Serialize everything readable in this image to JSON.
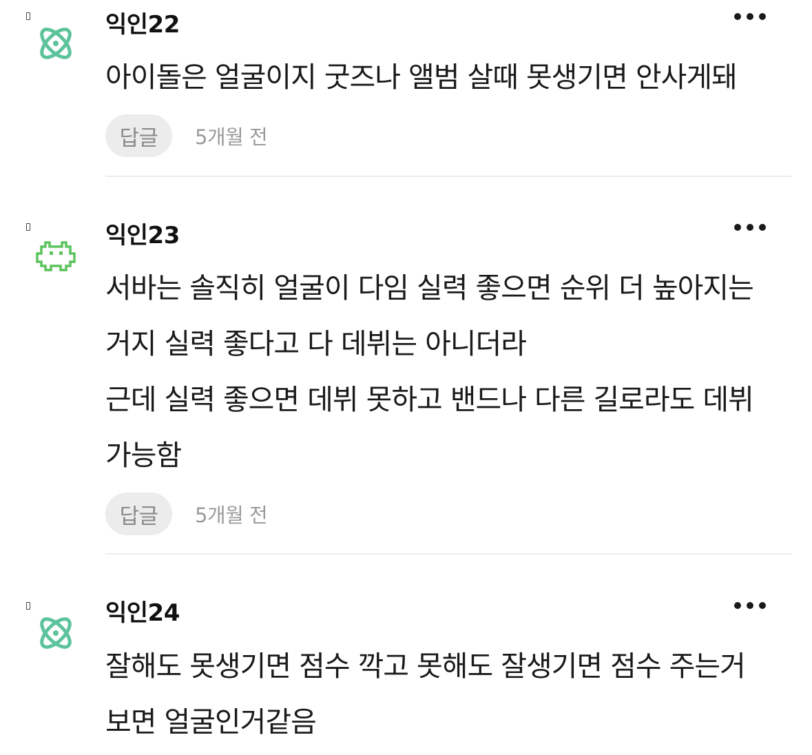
{
  "comments": [
    {
      "author": "익인22",
      "avatar_icon": "atom-icon",
      "lines": [
        "아이돌은 얼굴이지 굿즈나 앨범 살때 못생기면 안사게돼"
      ],
      "reply_label": "답글",
      "time": "5개월 전"
    },
    {
      "author": "익인23",
      "avatar_icon": "space-invader-icon",
      "lines": [
        "서바는 솔직히 얼굴이 다임 실력 좋으면 순위 더 높아지는",
        "거지 실력 좋다고 다 데뷔는 아니더라",
        "근데 실력 좋으면 데뷔 못하고 밴드나 다른 길로라도 데뷔",
        "가능함"
      ],
      "reply_label": "답글",
      "time": "5개월 전"
    },
    {
      "author": "익인24",
      "avatar_icon": "atom-icon",
      "lines": [
        "잘해도 못생기면 점수 깍고 못해도 잘생기면 점수 주는거",
        "보면 얼굴인거같음"
      ]
    }
  ],
  "colors": {
    "atom": "#5cc39a",
    "invader": "#5cc35c",
    "reply_bg": "#ececec",
    "divider": "#ececec"
  }
}
